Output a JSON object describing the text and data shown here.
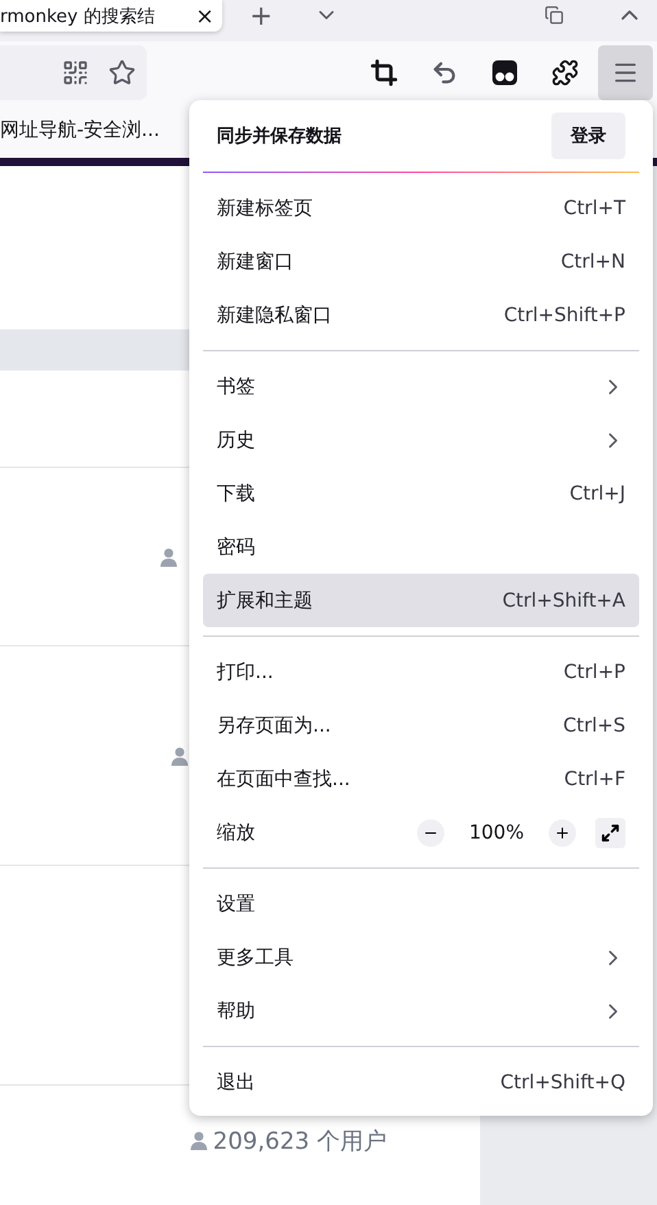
{
  "tab_strip": {
    "active_tab": {
      "title": "rmonkey 的搜索结",
      "close": "×"
    },
    "new_tab": "+"
  },
  "bookmarks_bar": {
    "items": [
      "网址导航-安全浏..."
    ]
  },
  "page": {
    "user_counts": [
      {
        "text": "209,623 个用户"
      }
    ]
  },
  "app_menu": {
    "header": {
      "title": "同步并保存数据",
      "button": "登录"
    },
    "items": [
      {
        "kind": "item",
        "label": "新建标签页",
        "shortcut": "Ctrl+T",
        "submenu": false,
        "selected": false
      },
      {
        "kind": "item",
        "label": "新建窗口",
        "shortcut": "Ctrl+N",
        "submenu": false,
        "selected": false
      },
      {
        "kind": "item",
        "label": "新建隐私窗口",
        "shortcut": "Ctrl+Shift+P",
        "submenu": false,
        "selected": false
      },
      {
        "kind": "separator"
      },
      {
        "kind": "item",
        "label": "书签",
        "submenu": true,
        "selected": false
      },
      {
        "kind": "item",
        "label": "历史",
        "submenu": true,
        "selected": false
      },
      {
        "kind": "item",
        "label": "下载",
        "shortcut": "Ctrl+J",
        "submenu": false,
        "selected": false
      },
      {
        "kind": "item",
        "label": "密码",
        "submenu": false,
        "selected": false
      },
      {
        "kind": "item",
        "label": "扩展和主题",
        "shortcut": "Ctrl+Shift+A",
        "submenu": false,
        "selected": true
      },
      {
        "kind": "separator"
      },
      {
        "kind": "item",
        "label": "打印...",
        "shortcut": "Ctrl+P",
        "submenu": false,
        "selected": false
      },
      {
        "kind": "item",
        "label": "另存页面为...",
        "shortcut": "Ctrl+S",
        "submenu": false,
        "selected": false
      },
      {
        "kind": "item",
        "label": "在页面中查找...",
        "shortcut": "Ctrl+F",
        "submenu": false,
        "selected": false
      },
      {
        "kind": "zoom",
        "label": "缩放",
        "value": "100%"
      },
      {
        "kind": "separator"
      },
      {
        "kind": "item",
        "label": "设置",
        "submenu": false,
        "selected": false
      },
      {
        "kind": "item",
        "label": "更多工具",
        "submenu": true,
        "selected": false
      },
      {
        "kind": "item",
        "label": "帮助",
        "submenu": true,
        "selected": false
      },
      {
        "kind": "separator"
      },
      {
        "kind": "item",
        "label": "退出",
        "shortcut": "Ctrl+Shift+Q",
        "submenu": false,
        "selected": false
      }
    ]
  }
}
